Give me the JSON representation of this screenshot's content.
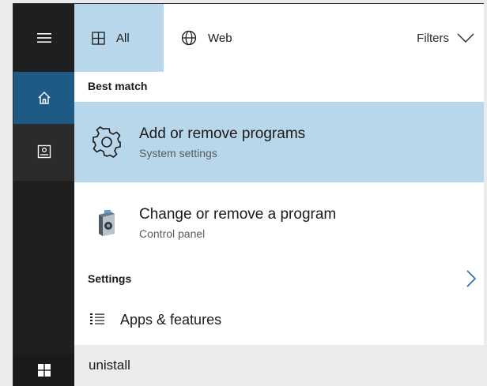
{
  "tabs": {
    "all_label": "All",
    "web_label": "Web",
    "filters_label": "Filters"
  },
  "sections": {
    "best_match": "Best match",
    "settings": "Settings"
  },
  "results": [
    {
      "title": "Add or remove programs",
      "subtitle": "System settings",
      "icon": "gear-icon",
      "selected": true
    },
    {
      "title": "Change or remove a program",
      "subtitle": "Control panel",
      "icon": "control-panel-icon",
      "selected": false
    }
  ],
  "settings_items": [
    {
      "label": "Apps & features",
      "icon": "list-icon"
    }
  ],
  "search": {
    "value": "unistall"
  },
  "colors": {
    "rail": "#1f1f1f",
    "rail_home_active": "#1f5a85",
    "selection": "#b9d7ea",
    "chevron_accent": "#1f6fb0"
  }
}
